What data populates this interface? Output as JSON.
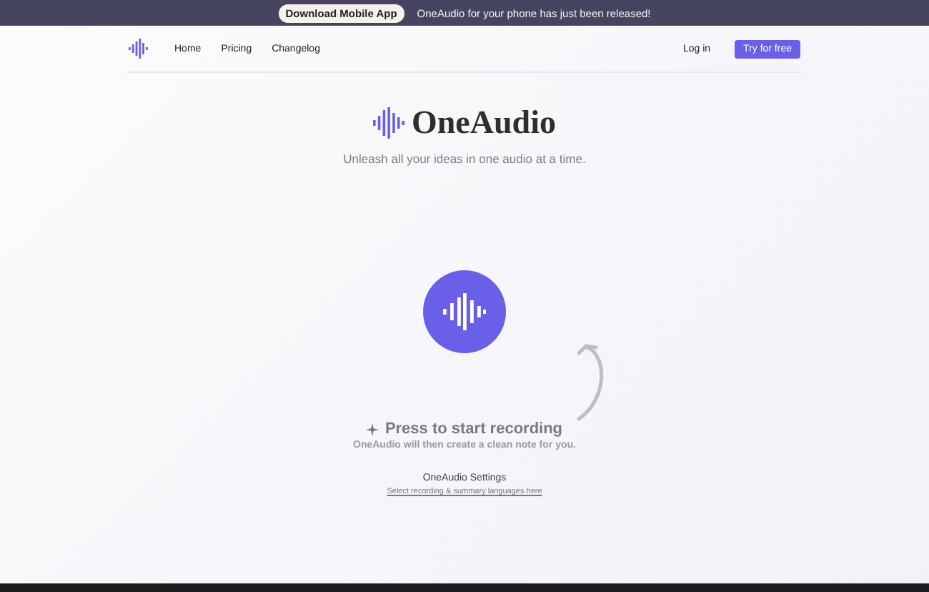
{
  "banner": {
    "button": "Download Mobile App",
    "message": "OneAudio for your phone has just been released!"
  },
  "nav": {
    "links": [
      "Home",
      "Pricing",
      "Changelog"
    ],
    "login": "Log in",
    "cta": "Try for free"
  },
  "hero": {
    "title": "OneAudio",
    "subtitle": "Unleash all your ideas in one audio at a time."
  },
  "record": {
    "prompt": "Press to start recording",
    "hint": "OneAudio will then create a clean note for you."
  },
  "settings": {
    "title": "OneAudio Settings",
    "link": "Select recording & summary languages here"
  }
}
